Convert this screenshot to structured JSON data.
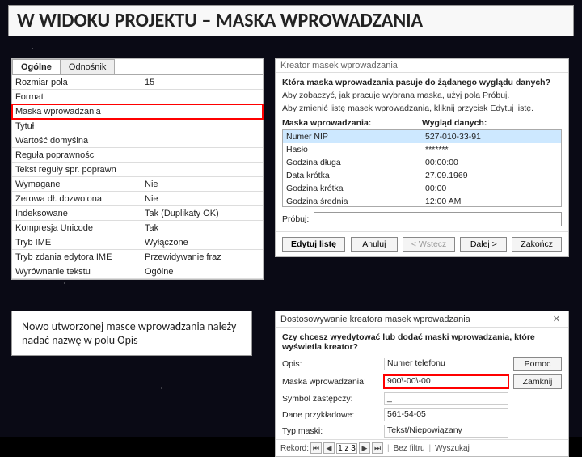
{
  "heading": "W WIDOKU PROJEKTU – MASKA WPROWADZANIA",
  "props": {
    "tabs": [
      "Ogólne",
      "Odnośnik"
    ],
    "rows": [
      {
        "k": "Rozmiar pola",
        "v": "15"
      },
      {
        "k": "Format",
        "v": ""
      },
      {
        "k": "Maska wprowadzania",
        "v": "",
        "hl": true
      },
      {
        "k": "Tytuł",
        "v": ""
      },
      {
        "k": "Wartość domyślna",
        "v": ""
      },
      {
        "k": "Reguła poprawności",
        "v": ""
      },
      {
        "k": "Tekst reguły spr. poprawn",
        "v": ""
      },
      {
        "k": "Wymagane",
        "v": "Nie"
      },
      {
        "k": "Zerowa dł. dozwolona",
        "v": "Nie"
      },
      {
        "k": "Indeksowane",
        "v": "Tak (Duplikaty OK)"
      },
      {
        "k": "Kompresja Unicode",
        "v": "Tak"
      },
      {
        "k": "Tryb IME",
        "v": "Wyłączone"
      },
      {
        "k": "Tryb zdania edytora IME",
        "v": "Przewidywanie fraz"
      },
      {
        "k": "Wyrównanie tekstu",
        "v": "Ogólne"
      }
    ]
  },
  "wizard": {
    "title": "Kreator masek wprowadzania",
    "q": "Która maska wprowadzania pasuje do żądanego wyglądu danych?",
    "inst1": "Aby zobaczyć, jak pracuje wybrana maska, użyj pola Próbuj.",
    "inst2": "Aby zmienić listę masek wprowadzania, kliknij przycisk Edytuj listę.",
    "col1": "Maska wprowadzania:",
    "col2": "Wygląd danych:",
    "items": [
      {
        "a": "Numer NIP",
        "b": "527-010-33-91",
        "sel": true
      },
      {
        "a": "Hasło",
        "b": "*******"
      },
      {
        "a": "Godzina długa",
        "b": "00:00:00"
      },
      {
        "a": "Data krótka",
        "b": "27.09.1969"
      },
      {
        "a": "Godzina krótka",
        "b": "00:00"
      },
      {
        "a": "Godzina średnia",
        "b": "12:00 AM"
      }
    ],
    "try_label": "Próbuj:",
    "btns": {
      "edit": "Edytuj listę",
      "cancel": "Anuluj",
      "back": "< Wstecz",
      "next": "Dalej >",
      "finish": "Zakończ"
    }
  },
  "note": "Nowo utworzonej masce wprowadzania należy nadać nazwę w polu Opis",
  "cust": {
    "title": "Dostosowywanie kreatora masek wprowadzania",
    "q": "Czy chcesz wyedytować lub dodać maski wprowadzania, które wyświetla kreator?",
    "rows": [
      {
        "label": "Opis:",
        "val": "Numer telefonu",
        "btn": "Pomoc"
      },
      {
        "label": "Maska wprowadzania:",
        "val": "900\\-00\\-00",
        "hl": true,
        "btn": "Zamknij"
      },
      {
        "label": "Symbol zastępczy:",
        "val": "_"
      },
      {
        "label": "Dane przykładowe:",
        "val": "561-54-05"
      },
      {
        "label": "Typ maski:",
        "val": "Tekst/Niepowiązany"
      }
    ],
    "nav": {
      "label": "Rekord:",
      "pos": "1 z 3",
      "filter": "Bez filtru",
      "search": "Wyszukaj"
    }
  }
}
